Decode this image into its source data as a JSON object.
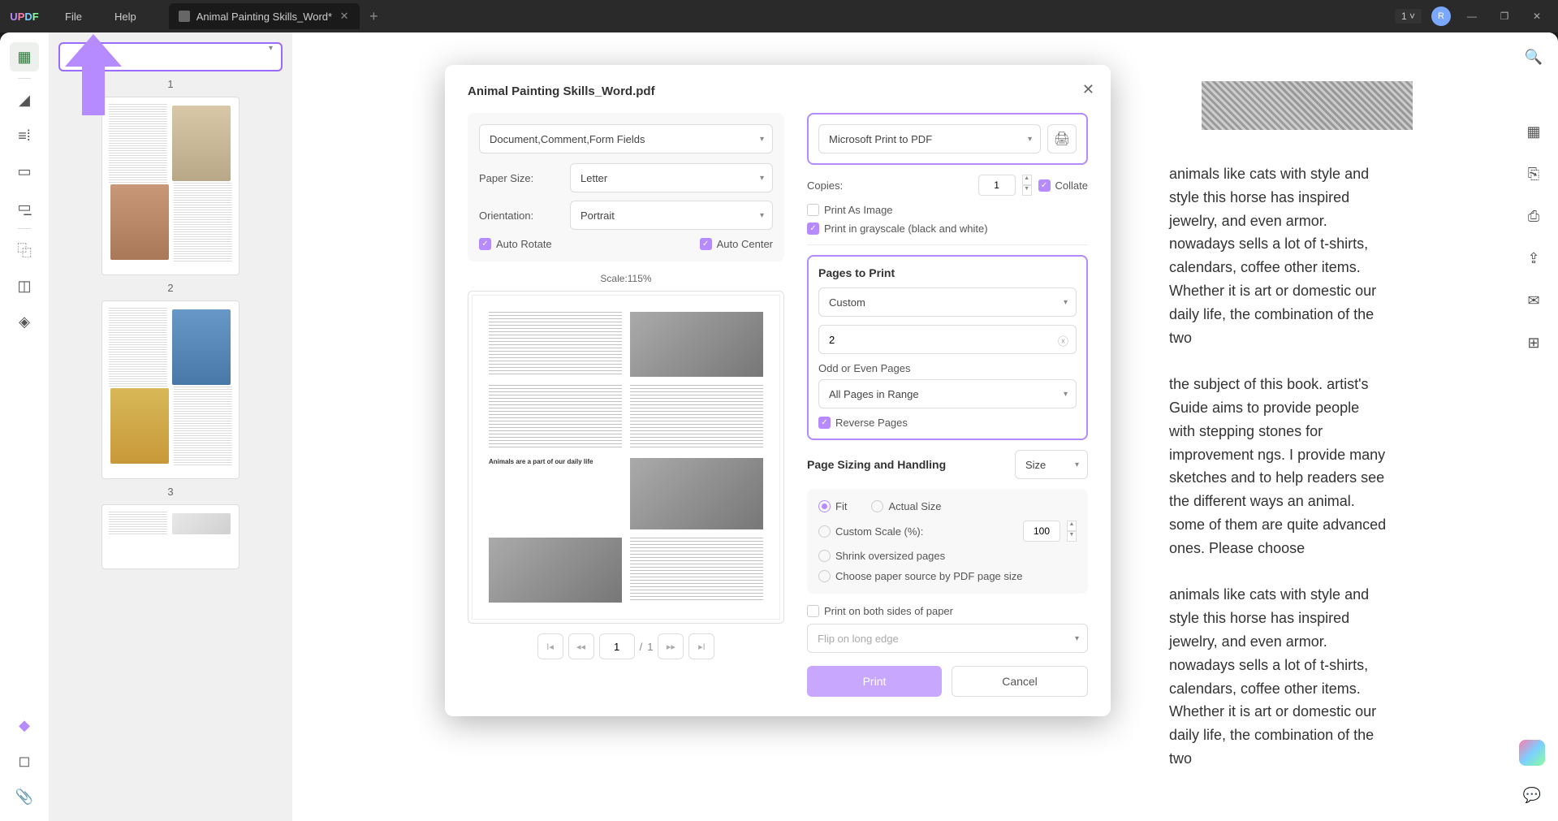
{
  "titlebar": {
    "menu_file": "File",
    "menu_help": "Help",
    "tab_title": "Animal Painting Skills_Word*",
    "badge": "1",
    "avatar_initial": "R"
  },
  "thumbs": [
    "1",
    "2",
    "3"
  ],
  "doc": {
    "body": "animals like cats with style and style this horse has inspired jewelry, and even armor. nowadays sells a lot of t-shirts, calendars, coffee other items. Whether it is art or domestic our daily life, the combination of the two\n\nthe subject of this book. artist's Guide aims to provide people with stepping stones for improvement ngs. I provide many sketches and to help readers see the different ways an animal. some of them are quite advanced ones. Please choose\n\nanimals like cats with style and style this horse has inspired jewelry, and even armor. nowadays sells a lot of t-shirts, calendars, coffee other items. Whether it is art or domestic our daily life, the combination of the two"
  },
  "print": {
    "title": "Animal Painting Skills_Word.pdf",
    "content_sel": "Document,Comment,Form Fields",
    "paper_label": "Paper Size:",
    "paper_value": "Letter",
    "orient_label": "Orientation:",
    "orient_value": "Portrait",
    "auto_rotate": "Auto Rotate",
    "auto_center": "Auto Center",
    "scale": "Scale:115%",
    "preview_heading": "Animals are a part of our daily life",
    "pager_cur": "1",
    "pager_sep": "/",
    "pager_total": "1",
    "printer": "Microsoft Print to PDF",
    "copies_label": "Copies:",
    "copies_value": "1",
    "collate": "Collate",
    "print_as_image": "Print As Image",
    "grayscale": "Print in grayscale (black and white)",
    "pages_title": "Pages to Print",
    "pages_mode": "Custom",
    "pages_value": "2",
    "odd_even_label": "Odd or Even Pages",
    "odd_even_value": "All Pages in Range",
    "reverse": "Reverse Pages",
    "sizing_title": "Page Sizing and Handling",
    "size_sel": "Size",
    "fit": "Fit",
    "actual": "Actual Size",
    "custom_scale": "Custom Scale (%):",
    "custom_scale_val": "100",
    "shrink": "Shrink oversized pages",
    "choose_source": "Choose paper source by PDF page size",
    "both_sides": "Print on both sides of paper",
    "flip": "Flip on long edge",
    "print_btn": "Print",
    "cancel_btn": "Cancel"
  }
}
